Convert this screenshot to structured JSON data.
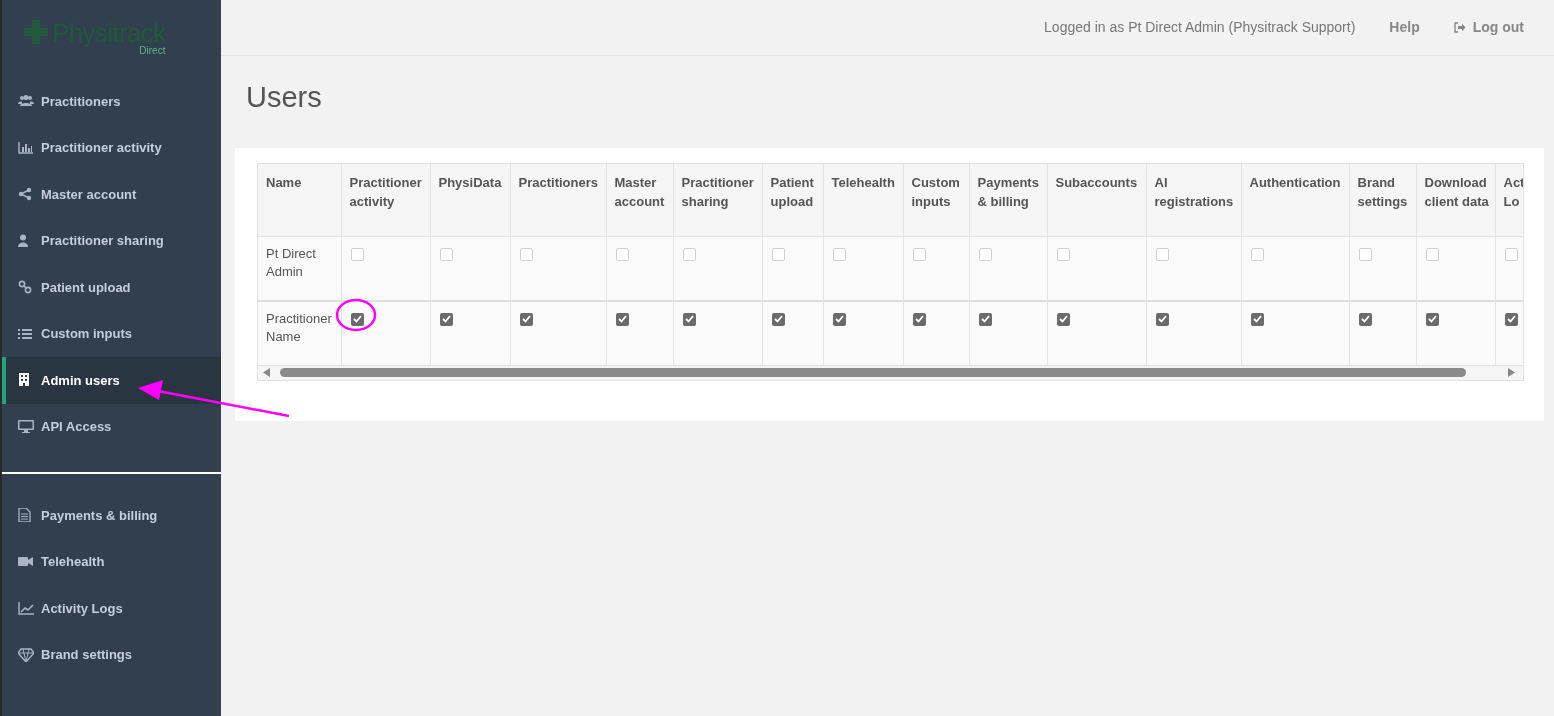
{
  "logo": {
    "name": "Physitrack",
    "sub": "Direct"
  },
  "sidebar": {
    "items": [
      {
        "label": "Practitioners",
        "selected": false
      },
      {
        "label": "Practitioner activity",
        "selected": false
      },
      {
        "label": "Master account",
        "selected": false
      },
      {
        "label": "Practitioner sharing",
        "selected": false
      },
      {
        "label": "Patient upload",
        "selected": false
      },
      {
        "label": "Custom inputs",
        "selected": false
      },
      {
        "label": "Admin users",
        "selected": true
      },
      {
        "label": "API Access",
        "selected": false
      }
    ],
    "bottom_items": [
      {
        "label": "Payments & billing",
        "selected": false
      },
      {
        "label": "Telehealth",
        "selected": false
      },
      {
        "label": "Activity Logs",
        "selected": false
      },
      {
        "label": "Brand settings",
        "selected": false
      }
    ]
  },
  "header": {
    "logged_in": "Logged in as Pt Direct Admin (Physitrack Support)",
    "help": "Help",
    "logout": "Log out"
  },
  "page_title": "Users",
  "table": {
    "columns": [
      "Name",
      "Practitioner activity",
      "PhysiData",
      "Practitioners",
      "Master account",
      "Practitioner sharing",
      "Patient upload",
      "Telehealth",
      "Custom inputs",
      "Payments & billing",
      "Subaccounts",
      "AI registrations",
      "Authentication",
      "Brand settings",
      "Download client data",
      "Act Lo"
    ],
    "rows": [
      {
        "name": "Pt Direct Admin",
        "permissions": [
          {
            "checked": false
          },
          {
            "checked": false
          },
          {
            "checked": false
          },
          {
            "checked": false
          },
          {
            "checked": false
          },
          {
            "checked": false
          },
          {
            "checked": false
          },
          {
            "checked": false
          },
          {
            "checked": false
          },
          {
            "checked": false
          },
          {
            "checked": false
          },
          {
            "checked": false
          },
          {
            "checked": false
          },
          {
            "checked": false
          },
          {
            "checked": false
          }
        ]
      },
      {
        "name": "Practitioner Name",
        "permissions": [
          {
            "checked": true
          },
          {
            "checked": true
          },
          {
            "checked": true
          },
          {
            "checked": true
          },
          {
            "checked": true
          },
          {
            "checked": true
          },
          {
            "checked": true
          },
          {
            "checked": true
          },
          {
            "checked": true
          },
          {
            "checked": true
          },
          {
            "checked": true
          },
          {
            "checked": true
          },
          {
            "checked": true
          },
          {
            "checked": true
          },
          {
            "checked": true
          }
        ]
      }
    ]
  }
}
